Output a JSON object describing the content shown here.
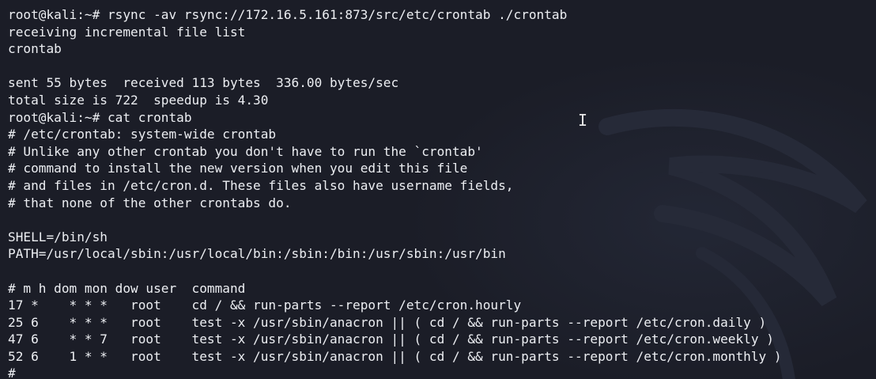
{
  "terminal": {
    "lines": [
      "root@kali:~# rsync -av rsync://172.16.5.161:873/src/etc/crontab ./crontab",
      "receiving incremental file list",
      "crontab",
      "",
      "sent 55 bytes  received 113 bytes  336.00 bytes/sec",
      "total size is 722  speedup is 4.30",
      "root@kali:~# cat crontab",
      "# /etc/crontab: system-wide crontab",
      "# Unlike any other crontab you don't have to run the `crontab'",
      "# command to install the new version when you edit this file",
      "# and files in /etc/cron.d. These files also have username fields,",
      "# that none of the other crontabs do.",
      "",
      "SHELL=/bin/sh",
      "PATH=/usr/local/sbin:/usr/local/bin:/sbin:/bin:/usr/sbin:/usr/bin",
      "",
      "# m h dom mon dow user  command",
      "17 *    * * *   root    cd / && run-parts --report /etc/cron.hourly",
      "25 6    * * *   root    test -x /usr/sbin/anacron || ( cd / && run-parts --report /etc/cron.daily )",
      "47 6    * * 7   root    test -x /usr/sbin/anacron || ( cd / && run-parts --report /etc/cron.weekly )",
      "52 6    1 * *   root    test -x /usr/sbin/anacron || ( cd / && run-parts --report /etc/cron.monthly )",
      "#"
    ],
    "cursor_glyph": "I",
    "colors": {
      "background": "#1b1d27",
      "foreground": "#eceef2"
    }
  }
}
